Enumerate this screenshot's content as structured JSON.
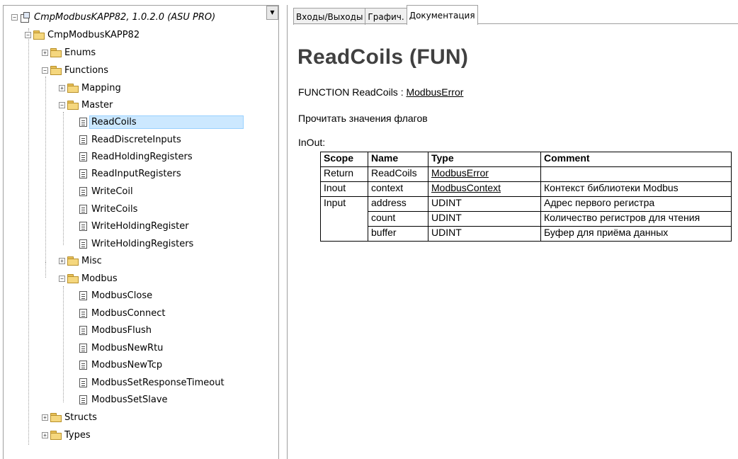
{
  "tree": {
    "root_label": "CmpModbusKAPP82, 1.0.2.0 (ASU PRO)",
    "library_label": "CmpModbusKAPP82",
    "enums": "Enums",
    "functions": "Functions",
    "mapping": "Mapping",
    "master": "Master",
    "master_items": [
      "ReadCoils",
      "ReadDiscreteInputs",
      "ReadHoldingRegisters",
      "ReadInputRegisters",
      "WriteCoil",
      "WriteCoils",
      "WriteHoldingRegister",
      "WriteHoldingRegisters"
    ],
    "misc": "Misc",
    "modbus": "Modbus",
    "modbus_items": [
      "ModbusClose",
      "ModbusConnect",
      "ModbusFlush",
      "ModbusNewRtu",
      "ModbusNewTcp",
      "ModbusSetResponseTimeout",
      "ModbusSetSlave"
    ],
    "structs": "Structs",
    "types": "Types",
    "expand_plus": "+",
    "expand_minus": "−"
  },
  "tabs": [
    "Входы/Выходы",
    "Графич.",
    "Документация"
  ],
  "doc": {
    "title": "ReadCoils (FUN)",
    "signature_prefix": "FUNCTION ReadCoils : ",
    "signature_type": "ModbusError",
    "description": "Прочитать значения флагов",
    "inout_label": "InOut:",
    "table_headers": [
      "Scope",
      "Name",
      "Type",
      "Comment"
    ],
    "rows": [
      {
        "scope": "Return",
        "name": "ReadCoils",
        "type": "ModbusError",
        "comment": ""
      },
      {
        "scope": "Inout",
        "name": "context",
        "type": "ModbusContext",
        "comment": "Контекст библиотеки Modbus"
      },
      {
        "scope": "Input",
        "name": "address",
        "type": "UDINT",
        "comment": "Адрес первого регистра"
      },
      {
        "scope": "",
        "name": "count",
        "type": "UDINT",
        "comment": "Количество регистров для чтения"
      },
      {
        "scope": "",
        "name": "buffer",
        "type": "UDINT",
        "comment": "Буфер для приёма данных"
      }
    ]
  }
}
